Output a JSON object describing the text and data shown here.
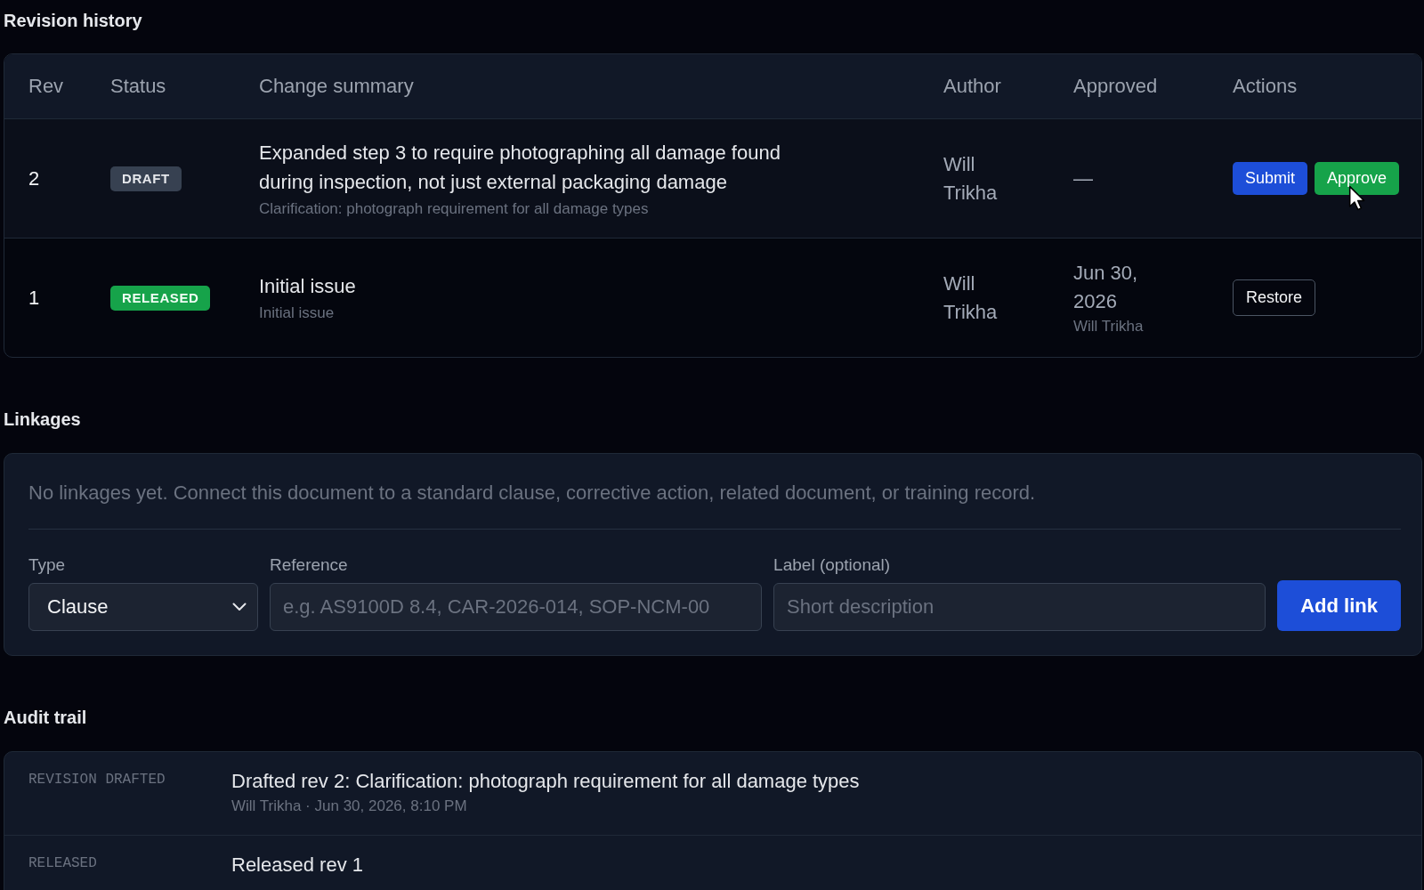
{
  "revision_history": {
    "title": "Revision history",
    "table": {
      "columns": [
        "Rev",
        "Status",
        "Change summary",
        "Author",
        "Approved",
        "Actions"
      ],
      "rows": [
        {
          "rev": "2",
          "status": {
            "label": "DRAFT",
            "kind": "draft"
          },
          "summary": "Expanded step 3 to require photographing all damage found during inspection, not just external packaging damage",
          "note": "Clarification: photograph requirement for all damage types",
          "author": "Will Trikha",
          "approved": "—",
          "actions": [
            {
              "label": "Submit",
              "kind": "primary"
            },
            {
              "label": "Approve",
              "kind": "success"
            }
          ],
          "highlighted": true
        },
        {
          "rev": "1",
          "status": {
            "label": "RELEASED",
            "kind": "released"
          },
          "summary": "Initial issue",
          "note": "Initial issue",
          "author": "Will Trikha",
          "approved": "Jun 30, 2026",
          "approved_by": "Will Trikha",
          "actions": [
            {
              "label": "Restore",
              "kind": "outline"
            }
          ],
          "highlighted": false
        }
      ]
    }
  },
  "linkages": {
    "title": "Linkages",
    "empty_message": "No linkages yet. Connect this document to a standard clause, corrective action, related document, or training record.",
    "form": {
      "type": {
        "label": "Type",
        "value": "Clause"
      },
      "reference": {
        "label": "Reference",
        "placeholder": "e.g. AS9100D 8.4, CAR-2026-014, SOP-NCM-00"
      },
      "link_label": {
        "label": "Label (optional)",
        "placeholder": "Short description"
      },
      "submit": "Add link"
    }
  },
  "audit_trail": {
    "title": "Audit trail",
    "entries": [
      {
        "event": "REVISION DRAFTED",
        "title": "Drafted rev 2: Clarification: photograph requirement for all damage types",
        "meta": "Will Trikha · Jun 30, 2026, 8:10 PM"
      },
      {
        "event": "RELEASED",
        "title": "Released rev 1"
      }
    ]
  }
}
